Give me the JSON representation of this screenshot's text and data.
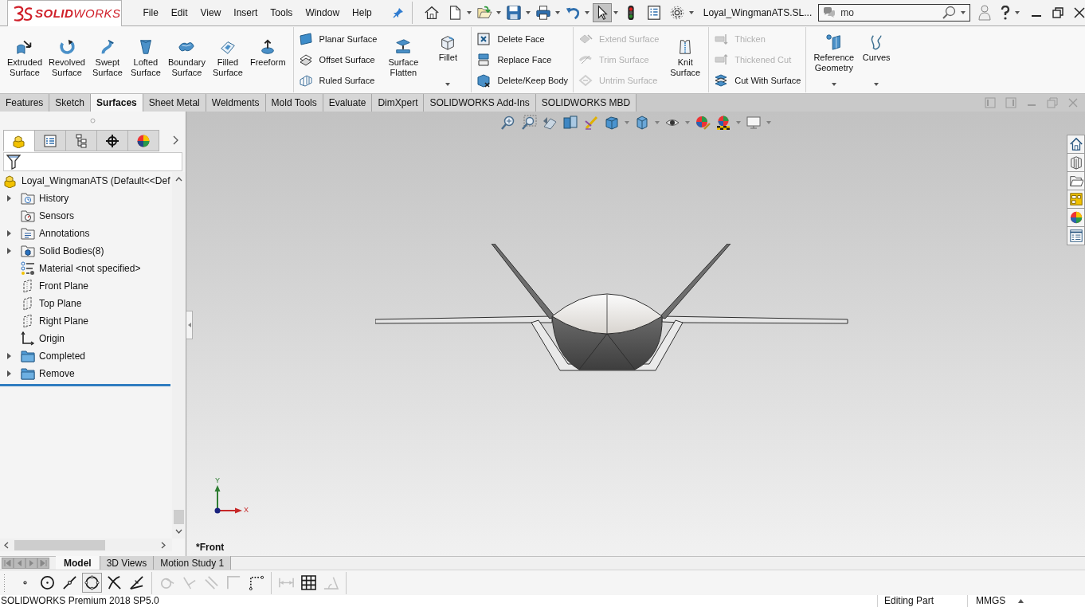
{
  "title_bar": {
    "logo": "**SOLID**WORKS",
    "menu": [
      "File",
      "Edit",
      "View",
      "Insert",
      "Tools",
      "Window",
      "Help"
    ],
    "quick_access": [
      {
        "kind": "home",
        "dropdown": false,
        "selected": false
      },
      {
        "kind": "new",
        "dropdown": true,
        "selected": false
      },
      {
        "kind": "open",
        "dropdown": true,
        "selected": false
      },
      {
        "kind": "save",
        "dropdown": true,
        "selected": false
      },
      {
        "kind": "print",
        "dropdown": true,
        "selected": false
      },
      {
        "kind": "undo",
        "dropdown": true,
        "selected": false
      },
      {
        "kind": "select",
        "dropdown": true,
        "selected": true
      },
      {
        "kind": "rebuild",
        "dropdown": false,
        "selected": false
      },
      {
        "kind": "properties",
        "dropdown": false,
        "selected": false
      },
      {
        "kind": "options",
        "dropdown": true,
        "selected": false
      }
    ],
    "document_title": "Loyal_WingmanATS.SL...",
    "search": {
      "value": "mo"
    }
  },
  "ribbon": {
    "sections": [
      {
        "blocks": [
          {
            "kind": "button",
            "label": "Extruded Surface",
            "dropdown": false,
            "disabled": false
          },
          {
            "kind": "button",
            "label": "Revolved Surface",
            "dropdown": false,
            "disabled": false
          },
          {
            "kind": "button",
            "label": "Swept Surface",
            "dropdown": false,
            "disabled": false
          },
          {
            "kind": "button",
            "label": "Lofted Surface",
            "dropdown": false,
            "disabled": false
          },
          {
            "kind": "button",
            "label": "Boundary Surface",
            "dropdown": false,
            "disabled": false
          },
          {
            "kind": "button",
            "label": "Filled Surface",
            "dropdown": false,
            "disabled": false
          },
          {
            "kind": "button",
            "label": "Freeform",
            "dropdown": false,
            "disabled": false
          }
        ]
      },
      {
        "blocks": [
          {
            "kind": "stack",
            "items": [
              {
                "label": "Planar Surface",
                "disabled": false
              },
              {
                "label": "Offset Surface",
                "disabled": false
              },
              {
                "label": "Ruled Surface",
                "disabled": false
              }
            ]
          },
          {
            "kind": "button",
            "label": "Surface Flatten",
            "dropdown": false,
            "disabled": false
          },
          {
            "kind": "button",
            "label": "Fillet",
            "dropdown": true,
            "disabled": false
          }
        ]
      },
      {
        "blocks": [
          {
            "kind": "stack",
            "items": [
              {
                "label": "Delete Face",
                "disabled": false
              },
              {
                "label": "Replace Face",
                "disabled": false
              },
              {
                "label": "Delete/Keep Body",
                "disabled": false
              }
            ]
          }
        ]
      },
      {
        "blocks": [
          {
            "kind": "stack",
            "items": [
              {
                "label": "Extend Surface",
                "disabled": true
              },
              {
                "label": "Trim Surface",
                "disabled": true
              },
              {
                "label": "Untrim Surface",
                "disabled": true
              }
            ]
          },
          {
            "kind": "button",
            "label": "Knit Surface",
            "dropdown": false,
            "disabled": false
          }
        ]
      },
      {
        "blocks": [
          {
            "kind": "stack",
            "items": [
              {
                "label": "Thicken",
                "disabled": true
              },
              {
                "label": "Thickened Cut",
                "disabled": true
              },
              {
                "label": "Cut With Surface",
                "disabled": false
              }
            ]
          }
        ]
      },
      {
        "blocks": [
          {
            "kind": "button",
            "label": "Reference Geometry",
            "dropdown": true,
            "disabled": false
          },
          {
            "kind": "button",
            "label": "Curves",
            "dropdown": true,
            "disabled": false
          }
        ]
      }
    ]
  },
  "command_tabs": [
    {
      "label": "Features",
      "selected": false
    },
    {
      "label": "Sketch",
      "selected": false
    },
    {
      "label": "Surfaces",
      "selected": true
    },
    {
      "label": "Sheet Metal",
      "selected": false
    },
    {
      "label": "Weldments",
      "selected": false
    },
    {
      "label": "Mold Tools",
      "selected": false
    },
    {
      "label": "Evaluate",
      "selected": false
    },
    {
      "label": "DimXpert",
      "selected": false
    },
    {
      "label": "SOLIDWORKS Add-Ins",
      "selected": false
    },
    {
      "label": "SOLIDWORKS MBD",
      "selected": false
    }
  ],
  "feature_tree": {
    "panel_tabs": [
      {
        "kind": "feature_manager",
        "selected": true
      },
      {
        "kind": "property_manager",
        "selected": false
      },
      {
        "kind": "configuration_manager",
        "selected": false
      },
      {
        "kind": "dimxpert_manager",
        "selected": false
      },
      {
        "kind": "display_manager",
        "selected": false
      }
    ],
    "root": "Loyal_WingmanATS (Default<<Def",
    "items": [
      {
        "label": "History",
        "kind": "history",
        "expandable": true
      },
      {
        "label": "Sensors",
        "kind": "sensors",
        "expandable": false
      },
      {
        "label": "Annotations",
        "kind": "annotations",
        "expandable": true
      },
      {
        "label": "Solid Bodies(8)",
        "kind": "solid_bodies",
        "expandable": true
      },
      {
        "label": "Material <not specified>",
        "kind": "material",
        "expandable": false
      },
      {
        "label": "Front Plane",
        "kind": "plane",
        "expandable": false
      },
      {
        "label": "Top Plane",
        "kind": "plane",
        "expandable": false
      },
      {
        "label": "Right Plane",
        "kind": "plane",
        "expandable": false
      },
      {
        "label": "Origin",
        "kind": "origin",
        "expandable": false
      },
      {
        "label": "Completed",
        "kind": "folder",
        "expandable": true
      },
      {
        "label": "Remove",
        "kind": "folder",
        "expandable": true
      }
    ]
  },
  "viewport": {
    "view_name": "*Front",
    "triad": {
      "x_label": "X",
      "y_label": "Y"
    }
  },
  "bottom_tabs": [
    {
      "label": "Model",
      "selected": true
    },
    {
      "label": "3D Views",
      "selected": false
    },
    {
      "label": "Motion Study 1",
      "selected": false
    }
  ],
  "sketch_toolbar": {
    "groups": [
      [
        {
          "kind": "point",
          "disabled": false,
          "selected": false
        },
        {
          "kind": "center_circle",
          "disabled": false,
          "selected": false
        },
        {
          "kind": "midpoint_line",
          "disabled": false,
          "selected": false
        },
        {
          "kind": "perimeter_circle",
          "disabled": false,
          "selected": true
        },
        {
          "kind": "trim",
          "disabled": false,
          "selected": false
        },
        {
          "kind": "extend",
          "disabled": false,
          "selected": false
        }
      ],
      [
        {
          "kind": "fillet",
          "disabled": true,
          "selected": false
        },
        {
          "kind": "chamfer",
          "disabled": true,
          "selected": false
        },
        {
          "kind": "offset",
          "disabled": true,
          "selected": false
        },
        {
          "kind": "corner",
          "disabled": true,
          "selected": false
        },
        {
          "kind": "dotted_corner",
          "disabled": false,
          "selected": false
        }
      ],
      [
        {
          "kind": "dimension",
          "disabled": true,
          "selected": false
        },
        {
          "kind": "grid",
          "disabled": false,
          "selected": false
        },
        {
          "kind": "angle",
          "disabled": true,
          "selected": false
        }
      ]
    ]
  },
  "status_bar": {
    "product": "SOLIDWORKS Premium 2018 SP5.0",
    "mode": "Editing Part",
    "units": "MMGS"
  }
}
